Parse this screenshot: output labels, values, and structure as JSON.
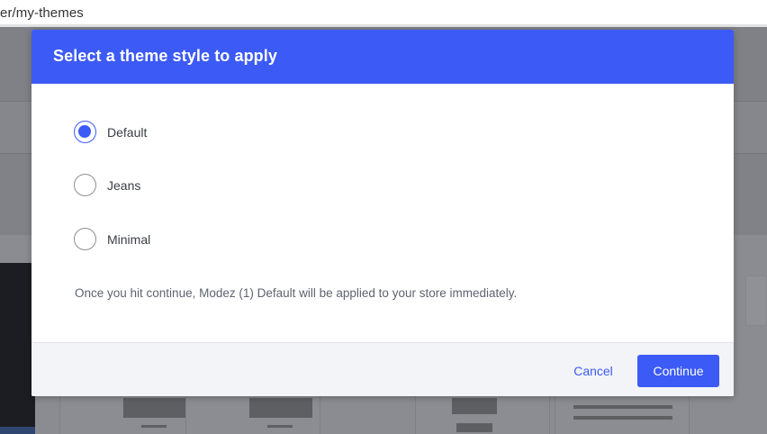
{
  "browser": {
    "url_fragment": "er/my-themes"
  },
  "modal": {
    "title": "Select a theme style to apply",
    "options": [
      {
        "label": "Default",
        "checked": true
      },
      {
        "label": "Jeans",
        "checked": false
      },
      {
        "label": "Minimal",
        "checked": false
      }
    ],
    "note": "Once you hit continue, Modez (1) Default will be applied to your store immediately.",
    "cancel_label": "Cancel",
    "continue_label": "Continue",
    "accent_color": "#3c5af5"
  }
}
